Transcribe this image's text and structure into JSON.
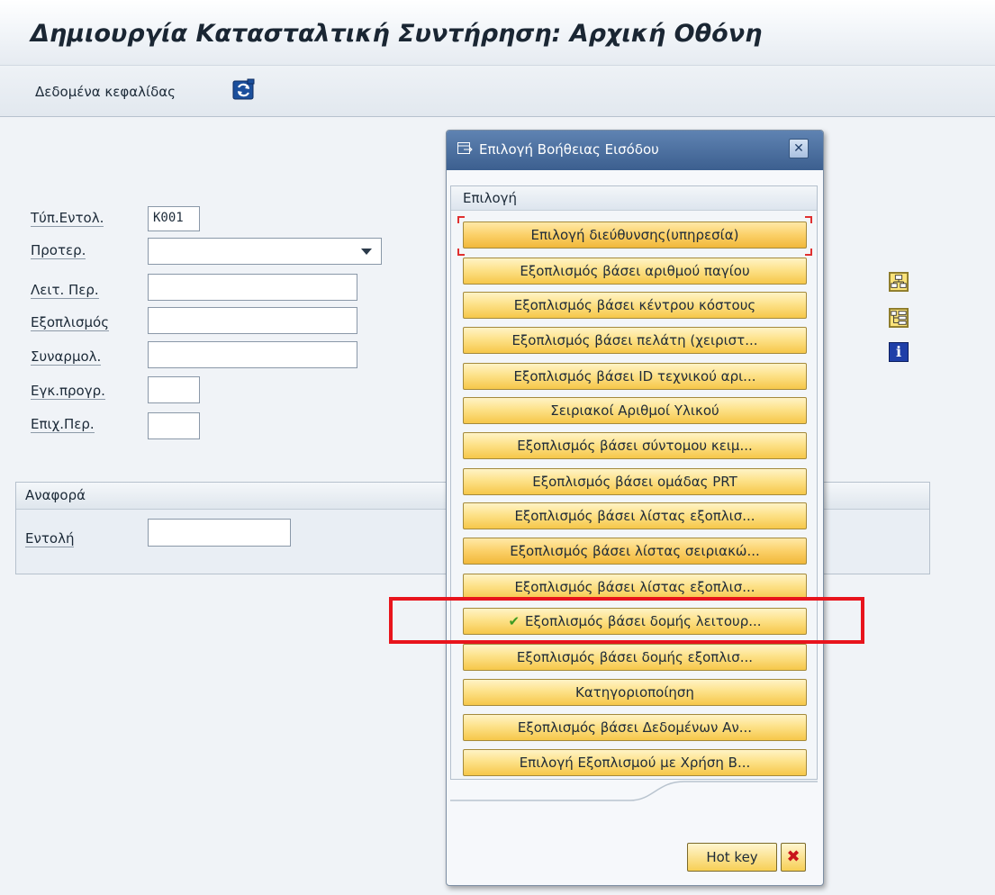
{
  "title": "Δημιουργία Κατασταλτική Συντήρηση: Αρχική Οθόνη",
  "toolbar": {
    "header_data_label": "Δεδομένα κεφαλίδας",
    "icons": [
      "refresh-icon"
    ]
  },
  "form": {
    "order_type": {
      "label": "Τύπ.Εντολ.",
      "value": "K001"
    },
    "priority": {
      "label": "Προτερ.",
      "value": ""
    },
    "func_location": {
      "label": "Λειτ. Περ.",
      "value": ""
    },
    "equipment": {
      "label": "Εξοπλισμός",
      "value": ""
    },
    "assembly": {
      "label": "Συναρμολ.",
      "value": ""
    },
    "planning_plant": {
      "label": "Εγκ.προγρ.",
      "value": ""
    },
    "business_area": {
      "label": "Επιχ.Περ.",
      "value": ""
    }
  },
  "reference": {
    "group_title": "Αναφορά",
    "order": {
      "label": "Εντολή",
      "value": ""
    }
  },
  "dialog": {
    "title": "Επιλογή Βοήθειας Εισόδου",
    "section_title": "Επιλογή",
    "options": [
      "Επιλογή διεύθυνσης(υπηρεσία)",
      "Εξοπλισμός βάσει αριθμού παγίου",
      "Εξοπλισμός βάσει κέντρου κόστους",
      "Εξοπλισμός βάσει πελάτη (χειριστ...",
      "Εξοπλισμός βάσει ID τεχνικού αρι...",
      "Σειριακοί Αριθμοί Υλικού",
      "Εξοπλισμός βάσει σύντομου κειμ...",
      "Εξοπλισμός βάσει ομάδας PRT",
      "Εξοπλισμός βάσει λίστας εξοπλισ...",
      "Εξοπλισμός βάσει λίστας σειριακώ...",
      "Εξοπλισμός βάσει λίστας εξοπλισ...",
      "Εξοπλισμός βάσει δομής λειτουρ...",
      "Εξοπλισμός βάσει δομής εξοπλισ...",
      "Κατηγοριοποίηση",
      "Εξοπλισμός βάσει Δεδομένων Αν...",
      "Επιλογή Εξοπλισμού με Χρήση Β..."
    ],
    "selected_index": 11,
    "hotkey_label": "Hot key",
    "close_symbol": "✕",
    "cancel_symbol": "✖"
  },
  "colors": {
    "dialog_header": "#4a6d9d",
    "option_button": "#fbd56b",
    "highlight": "#e8141c",
    "check": "#3d9a22"
  }
}
